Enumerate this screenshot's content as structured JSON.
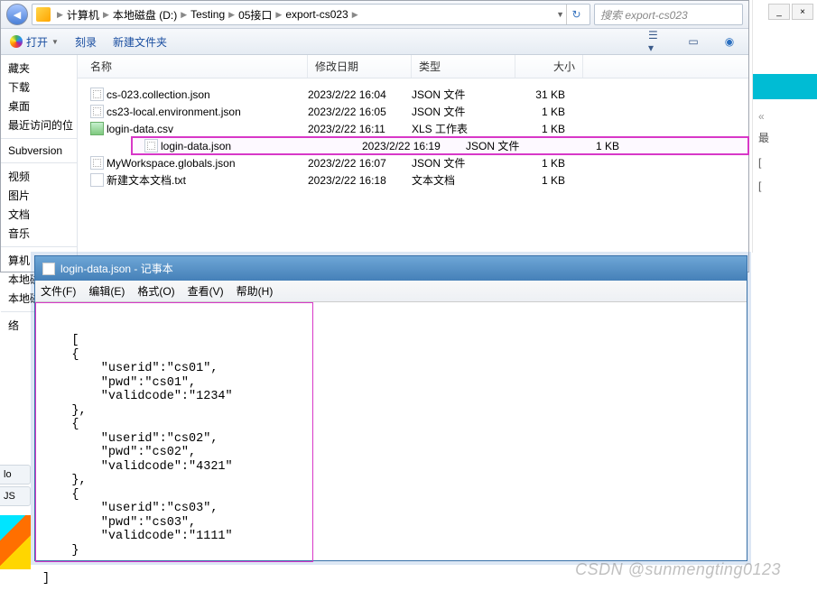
{
  "addressbar": {
    "refresh_icon": "↻",
    "search_placeholder": "搜索 export-cs023"
  },
  "breadcrumb": [
    "计算机",
    "本地磁盘 (D:)",
    "Testing",
    "05接口",
    "export-cs023"
  ],
  "toolbar": {
    "open": "打开",
    "burn": "刻录",
    "newfolder": "新建文件夹"
  },
  "sidebar": {
    "groups": [
      [
        "藏夹",
        "下载",
        "桌面",
        "最近访问的位"
      ],
      [
        "Subversion"
      ],
      [
        "视频",
        "图片",
        "文档",
        "音乐"
      ],
      [
        "算机",
        "本地磁",
        "本地磁"
      ],
      [
        "络"
      ]
    ]
  },
  "columns": {
    "name": "名称",
    "date": "修改日期",
    "type": "类型",
    "size": "大小"
  },
  "files": [
    {
      "name": "cs-023.collection.json",
      "date": "2023/2/22 16:04",
      "type": "JSON 文件",
      "size": "31 KB",
      "icon": "json"
    },
    {
      "name": "cs23-local.environment.json",
      "date": "2023/2/22 16:05",
      "type": "JSON 文件",
      "size": "1 KB",
      "icon": "json"
    },
    {
      "name": "login-data.csv",
      "date": "2023/2/22 16:11",
      "type": "XLS 工作表",
      "size": "1 KB",
      "icon": "csv"
    },
    {
      "name": "login-data.json",
      "date": "2023/2/22 16:19",
      "type": "JSON 文件",
      "size": "1 KB",
      "icon": "json",
      "highlight": true
    },
    {
      "name": "MyWorkspace.globals.json",
      "date": "2023/2/22 16:07",
      "type": "JSON 文件",
      "size": "1 KB",
      "icon": "json"
    },
    {
      "name": "新建文本文档.txt",
      "date": "2023/2/22 16:18",
      "type": "文本文档",
      "size": "1 KB",
      "icon": "txt"
    }
  ],
  "notepad": {
    "title": "login-data.json - 记事本",
    "menus": [
      "文件(F)",
      "编辑(E)",
      "格式(O)",
      "查看(V)",
      "帮助(H)"
    ],
    "content": "[\n    {\n        \"userid\":\"cs01\",\n        \"pwd\":\"cs01\",\n        \"validcode\":\"1234\"\n    },\n    {\n        \"userid\":\"cs02\",\n        \"pwd\":\"cs02\",\n        \"validcode\":\"4321\"\n    },\n    {\n        \"userid\":\"cs03\",\n        \"pwd\":\"cs03\",\n        \"validcode\":\"1111\"\n    }\n\n]"
  },
  "right": {
    "minimize": "_",
    "close": "×",
    "chev": "«",
    "items": [
      "最",
      "[",
      "["
    ]
  },
  "left_bottom": {
    "lo": "lo",
    "js": "JS"
  },
  "watermark": "CSDN @sunmengting0123"
}
